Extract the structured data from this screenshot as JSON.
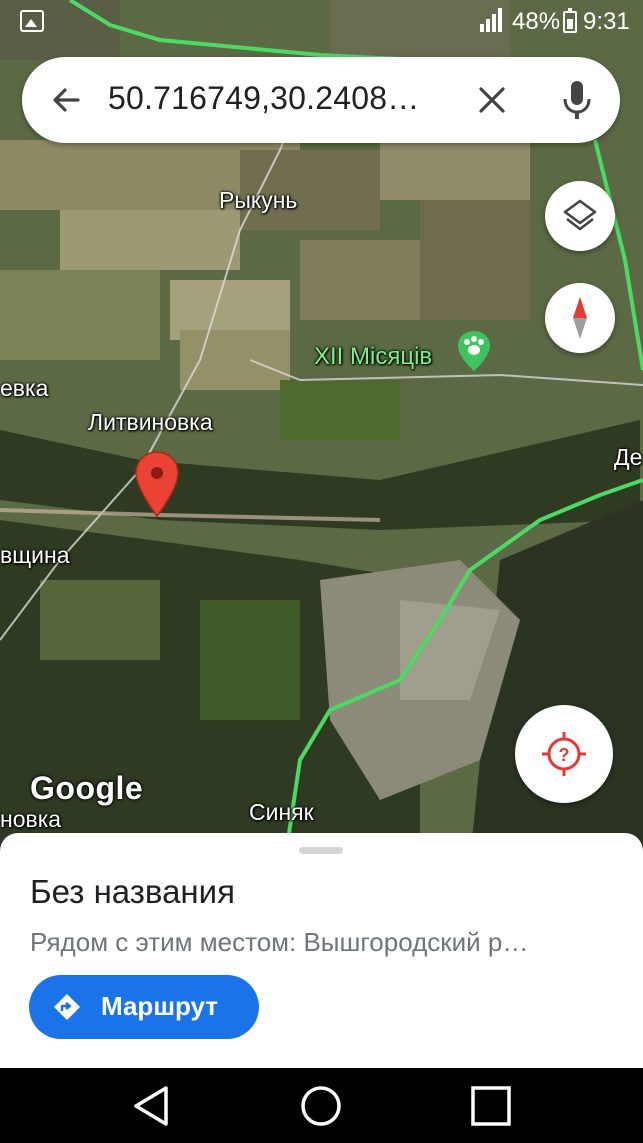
{
  "status_bar": {
    "battery": "48%",
    "time": "9:31"
  },
  "search": {
    "query": "50.716749,30.2408…"
  },
  "map": {
    "labels": {
      "rykun": "Рыкунь",
      "months": "XII Місяців",
      "evka": "евка",
      "litvinovka": "Литвиновка",
      "de": "Де",
      "vshchina": "вщина",
      "novka": "новка",
      "sinyak": "Синяк"
    },
    "attribution": "Google"
  },
  "sheet": {
    "title": "Без названия",
    "subtitle": "Рядом с этим местом: Вышгородский р…",
    "route_label": "Маршрут"
  },
  "colors": {
    "accent": "#1a73e8",
    "pin": "#ea4335",
    "traffic": "#4cd964",
    "poi": "#7cf08a"
  },
  "icons": {
    "back": "arrow-back-icon",
    "clear": "close-icon",
    "mic": "microphone-icon",
    "layers": "layers-icon",
    "compass": "compass-icon",
    "locate": "my-location-icon",
    "route": "directions-icon"
  }
}
